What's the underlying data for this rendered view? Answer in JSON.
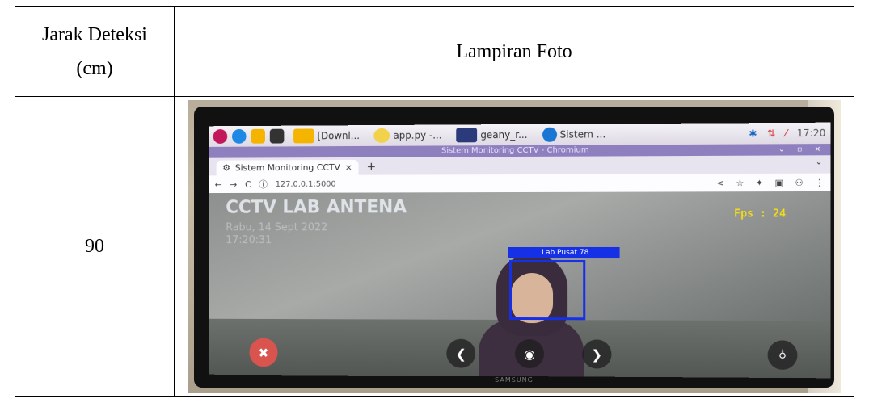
{
  "table": {
    "header_col1_line1": "Jarak Deteksi",
    "header_col1_line2": "(cm)",
    "header_col2": "Lampiran Foto",
    "row_distance": "90"
  },
  "photo": {
    "brand": "SAMSUNG",
    "taskbar": {
      "items": [
        "[Downl...",
        "app.py -...",
        "geany_r...",
        "Sistem ..."
      ],
      "clock": "17:20"
    },
    "browser": {
      "window_title": "Sistem Monitoring CCTV - Chromium",
      "tab_title": "Sistem Monitoring CCTV",
      "tab_close": "×",
      "new_tab": "+",
      "url": "127.0.0.1:5000"
    },
    "cctv": {
      "title": "CCTV LAB ANTENA",
      "date": "Rabu, 14 Sept 2022",
      "time": "17:20:31",
      "fps": "Fps : 24",
      "detection_label": "Lab Pusat    78"
    }
  },
  "colors": {
    "bbox": "#1630e6",
    "fps_text": "#f2dc1a",
    "close_button": "#d9534f",
    "titlebar": "#8e7fbf"
  }
}
